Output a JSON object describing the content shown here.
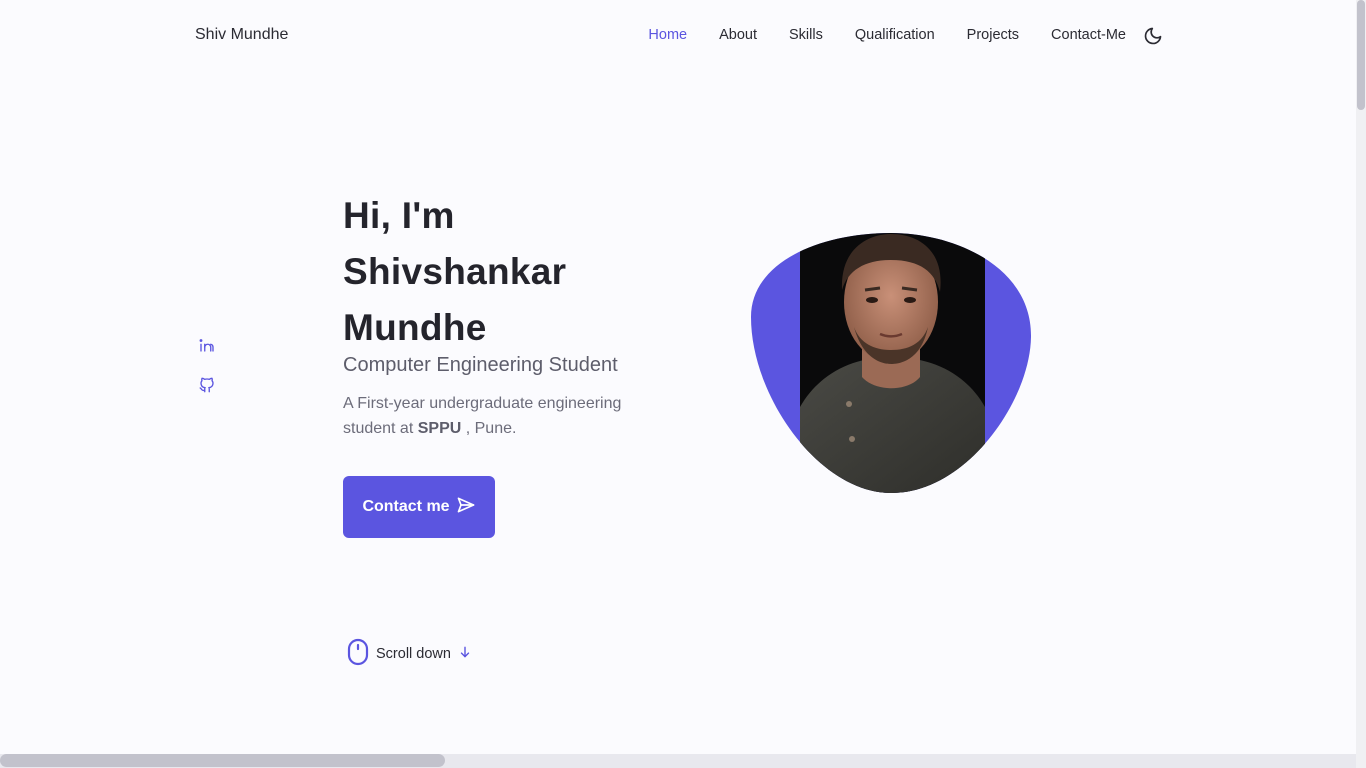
{
  "header": {
    "logo": "Shiv Mundhe",
    "nav": [
      {
        "label": "Home",
        "active": true
      },
      {
        "label": "About"
      },
      {
        "label": "Skills"
      },
      {
        "label": "Qualification"
      },
      {
        "label": "Projects"
      },
      {
        "label": "Contact-Me"
      }
    ],
    "theme_icon": "moon-icon"
  },
  "socials": [
    {
      "icon": "linkedin-icon"
    },
    {
      "icon": "github-icon"
    }
  ],
  "hero": {
    "title_line1": "Hi, I'm",
    "title_line2": "Shivshankar",
    "title_line3": "Mundhe",
    "subtitle": "Computer Engineering Student",
    "desc_part1": "A First-year undergraduate engineering student at ",
    "desc_bold": "SPPU",
    "desc_part2": " , Pune.",
    "button_label": "Contact me",
    "button_icon": "send-icon"
  },
  "scroll": {
    "label": "Scroll down",
    "icons": [
      "mouse-icon",
      "arrow-down-icon"
    ]
  },
  "colors": {
    "accent": "#5b55e0",
    "background": "#fbfbfe",
    "text": "#2b2b33"
  }
}
